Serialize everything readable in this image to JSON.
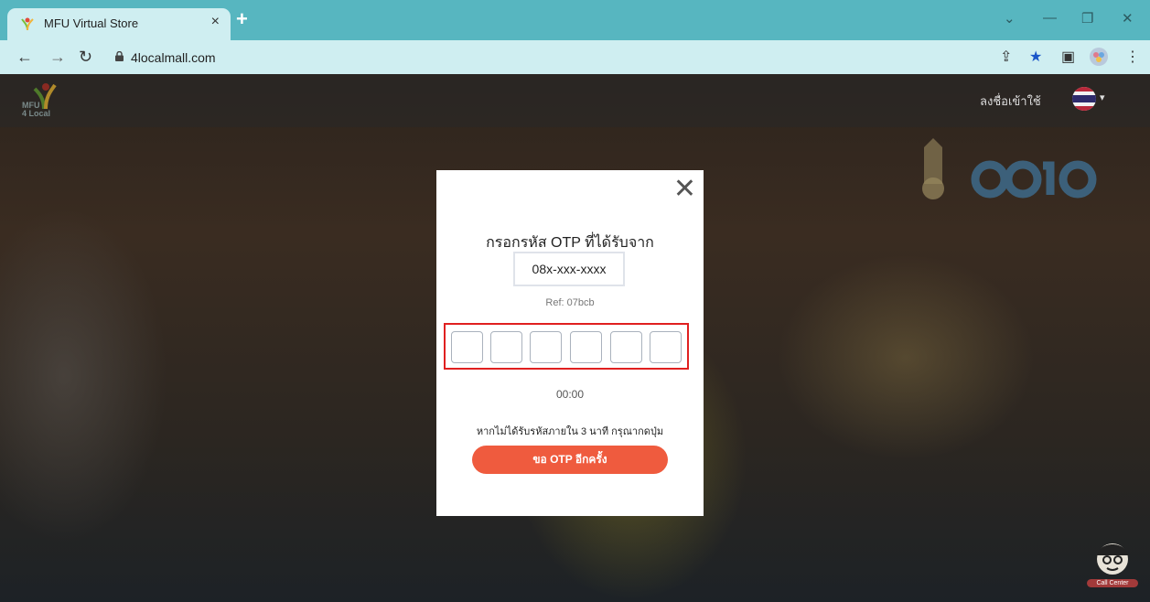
{
  "browser": {
    "tab_title": "MFU Virtual Store",
    "tab_close": "×",
    "new_tab": "+",
    "url": "4localmall.com",
    "window_controls": {
      "dropdown": "⌄",
      "minimize": "—",
      "restore": "❐",
      "close": "✕"
    },
    "nav": {
      "back": "←",
      "forward": "→",
      "reload": "↻"
    },
    "toolbar": {
      "share": "⇪",
      "bookmark": "★",
      "sidepanel": "▣",
      "menu": "⋮"
    }
  },
  "site": {
    "logo_text_line1": "MFU",
    "logo_text_line2": "4 Local",
    "signin_label": "ลงชื่อเข้าใช้",
    "lang_caret": "▾",
    "callcenter_label": "Call Center"
  },
  "modal": {
    "close": "✕",
    "title": "กรอกรหัส OTP ที่ได้รับจาก",
    "phone": "08x-xxx-xxxx",
    "ref": "Ref: 07bcb",
    "otp_digits": [
      "",
      "",
      "",
      "",
      "",
      ""
    ],
    "timer": "00:00",
    "hint": "หากไม่ได้รับรหัสภายใน 3 นาที กรุณากดปุ่ม",
    "resend_label": "ขอ OTP อีกครั้ง"
  },
  "colors": {
    "browser_frame": "#57b6c0",
    "browser_tab": "#cfeef1",
    "accent": "#ef5b3e",
    "highlight": "#e02020"
  }
}
